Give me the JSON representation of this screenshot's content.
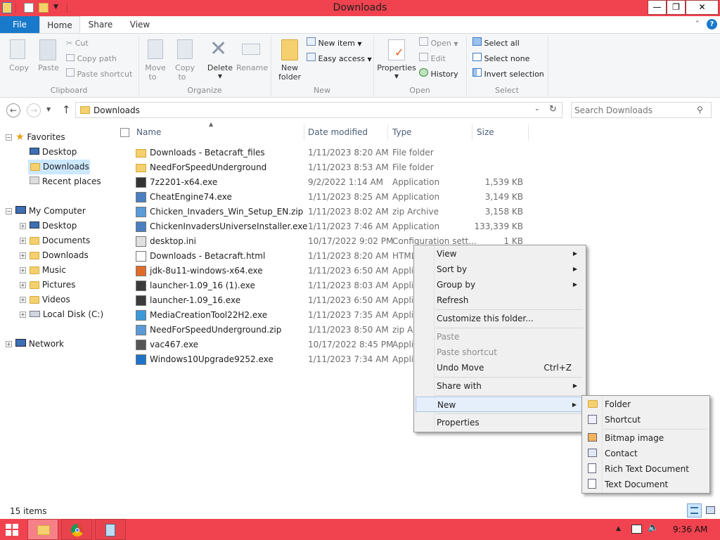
{
  "window": {
    "title": "Downloads"
  },
  "ribbon_tabs": {
    "file": "File",
    "home": "Home",
    "share": "Share",
    "view": "View"
  },
  "clipboard": {
    "copy": "Copy",
    "paste": "Paste",
    "cut": "Cut",
    "copy_path": "Copy path",
    "paste_shortcut": "Paste shortcut",
    "label": "Clipboard"
  },
  "organize": {
    "move_to_1": "Move",
    "move_to_2": "to",
    "copy_to_1": "Copy",
    "copy_to_2": "to",
    "delete": "Delete",
    "rename": "Rename",
    "label": "Organize"
  },
  "new_group": {
    "new_folder_1": "New",
    "new_folder_2": "folder",
    "new_item": "New item",
    "easy_access": "Easy access",
    "label": "New"
  },
  "open_group": {
    "properties": "Properties",
    "open": "Open",
    "edit": "Edit",
    "history": "History",
    "label": "Open"
  },
  "select_group": {
    "select_all": "Select all",
    "select_none": "Select none",
    "invert_selection": "Invert selection",
    "label": "Select"
  },
  "address": {
    "path": "Downloads"
  },
  "search": {
    "placeholder": "Search Downloads"
  },
  "nav": {
    "favorites": "Favorites",
    "fav_items": [
      "Desktop",
      "Downloads",
      "Recent places"
    ],
    "computer": "My Computer",
    "computer_items": [
      "Desktop",
      "Documents",
      "Downloads",
      "Music",
      "Pictures",
      "Videos",
      "Local Disk (C:)"
    ],
    "network": "Network"
  },
  "columns": {
    "name": "Name",
    "date": "Date modified",
    "type": "Type",
    "size": "Size"
  },
  "files": [
    {
      "name": "Downloads - Betacraft_files",
      "date": "1/11/2023 8:20 AM",
      "type": "File folder",
      "size": ""
    },
    {
      "name": "NeedForSpeedUnderground",
      "date": "1/11/2023 8:53 AM",
      "type": "File folder",
      "size": ""
    },
    {
      "name": "7z2201-x64.exe",
      "date": "9/2/2022 1:14 AM",
      "type": "Application",
      "size": "1,539 KB"
    },
    {
      "name": "CheatEngine74.exe",
      "date": "1/11/2023 8:25 AM",
      "type": "Application",
      "size": "3,149 KB"
    },
    {
      "name": "Chicken_Invaders_Win_Setup_EN.zip",
      "date": "1/11/2023 8:02 AM",
      "type": "zip Archive",
      "size": "3,158 KB"
    },
    {
      "name": "ChickenInvadersUniverseInstaller.exe",
      "date": "1/11/2023 7:46 AM",
      "type": "Application",
      "size": "133,339 KB"
    },
    {
      "name": "desktop.ini",
      "date": "10/17/2022 9:02 PM",
      "type": "Configuration sett...",
      "size": "1 KB"
    },
    {
      "name": "Downloads - Betacraft.html",
      "date": "1/11/2023 8:20 AM",
      "type": "HTML",
      "size": ""
    },
    {
      "name": "jdk-8u11-windows-x64.exe",
      "date": "1/11/2023 6:50 AM",
      "type": "Appli",
      "size": ""
    },
    {
      "name": "launcher-1.09_16 (1).exe",
      "date": "1/11/2023 8:03 AM",
      "type": "Appli",
      "size": ""
    },
    {
      "name": "launcher-1.09_16.exe",
      "date": "1/11/2023 6:50 AM",
      "type": "Appli",
      "size": ""
    },
    {
      "name": "MediaCreationTool22H2.exe",
      "date": "1/11/2023 7:35 AM",
      "type": "Appli",
      "size": ""
    },
    {
      "name": "NeedForSpeedUnderground.zip",
      "date": "1/11/2023 8:50 AM",
      "type": "zip Ar",
      "size": ""
    },
    {
      "name": "vac467.exe",
      "date": "10/17/2022 8:45 PM",
      "type": "Appli",
      "size": ""
    },
    {
      "name": "Windows10Upgrade9252.exe",
      "date": "1/11/2023 7:34 AM",
      "type": "Appli",
      "size": ""
    }
  ],
  "context_menu": {
    "view": "View",
    "sort_by": "Sort by",
    "group_by": "Group by",
    "refresh": "Refresh",
    "customize": "Customize this folder...",
    "paste": "Paste",
    "paste_shortcut": "Paste shortcut",
    "undo_move": "Undo Move",
    "undo_key": "Ctrl+Z",
    "share_with": "Share with",
    "new": "New",
    "properties": "Properties"
  },
  "new_submenu": {
    "folder": "Folder",
    "shortcut": "Shortcut",
    "bitmap": "Bitmap image",
    "contact": "Contact",
    "rich_text": "Rich Text Document",
    "text": "Text Document"
  },
  "status": {
    "items": "15 items"
  },
  "taskbar": {
    "clock": "9:36 AM"
  },
  "colors": {
    "titlebar": "#f0434f",
    "file_tab": "#1979ca",
    "selection": "#cce8ff"
  }
}
